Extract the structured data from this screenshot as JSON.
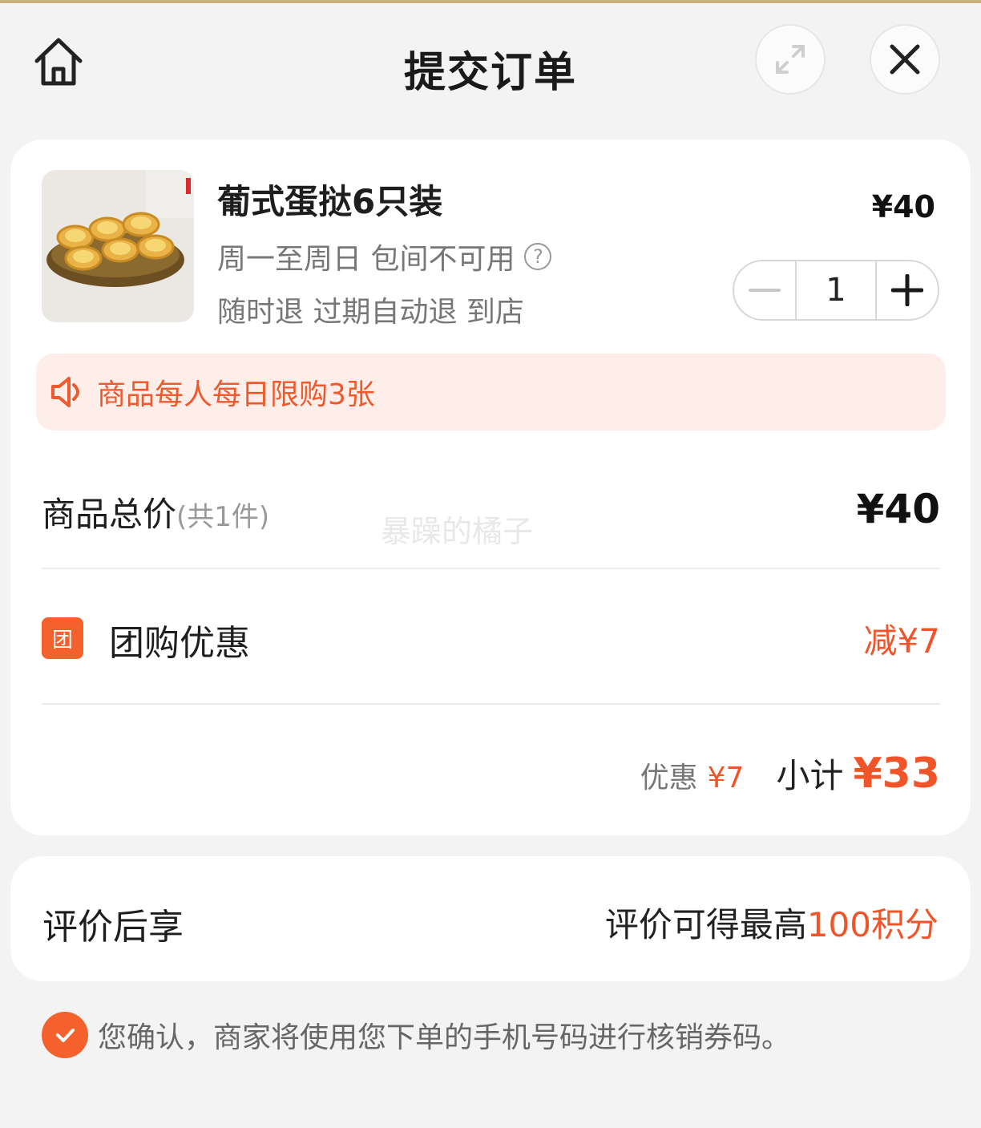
{
  "header": {
    "title": "提交订单",
    "home_icon": "home-icon",
    "expand_icon": "expand-icon",
    "close_icon": "close-icon"
  },
  "product": {
    "name": "葡式蛋挞6只装",
    "tag_line1": "周一至周日 包间不可用",
    "tag_help": "?",
    "tag_line2": "随时退 过期自动退 到店",
    "price": "¥40",
    "quantity": "1"
  },
  "notice": {
    "icon": "speaker-icon",
    "text": "商品每人每日限购3张"
  },
  "summary": {
    "total_label": "商品总价",
    "total_count": "(共1件)",
    "total_price": "¥40",
    "group_icon_text": "团",
    "group_label": "团购优惠",
    "group_value": "减¥7",
    "discount_label": "优惠",
    "discount_value": "¥7",
    "subtotal_label": "小计",
    "subtotal_value": "¥33"
  },
  "review": {
    "label": "评价后享",
    "value_prefix": "评价可得最高",
    "value_highlight": "100积分"
  },
  "confirm": {
    "text": "您确认，商家将使用您下单的手机号码进行核销券码。"
  },
  "watermark": "暴躁的橘子",
  "colors": {
    "accent": "#f0552a",
    "notice_bg": "#fdeee9",
    "page_bg": "#f3f3f3"
  }
}
